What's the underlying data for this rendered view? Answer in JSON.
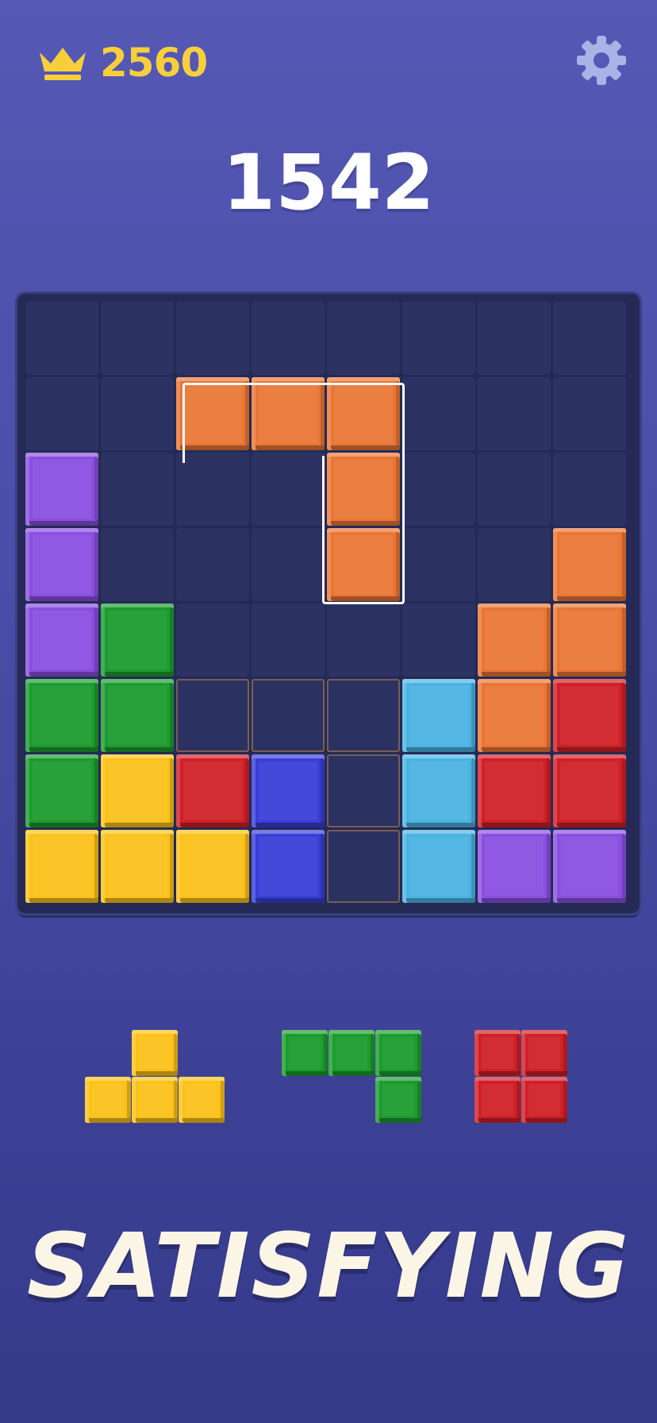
{
  "header": {
    "best_score": "2560",
    "current_score": "1542"
  },
  "colors": {
    "orange": "#ea7636",
    "purple": "#8a4fe0",
    "green": "#1c9c2e",
    "yellow": "#fbc21a",
    "red": "#d02027",
    "blue": "#3a3ed8",
    "cyan": "#4bb3e3",
    "empty": "#2c3363"
  },
  "board": {
    "rows": [
      [
        "empty",
        "empty",
        "empty",
        "empty",
        "empty",
        "empty",
        "empty",
        "empty"
      ],
      [
        "empty",
        "empty",
        "orange",
        "orange",
        "orange",
        "empty",
        "empty",
        "empty"
      ],
      [
        "purple",
        "empty",
        "empty",
        "empty",
        "orange",
        "empty",
        "empty",
        "empty"
      ],
      [
        "purple",
        "empty",
        "empty",
        "empty",
        "orange",
        "empty",
        "empty",
        "orange"
      ],
      [
        "purple",
        "green",
        "empty",
        "empty",
        "empty",
        "empty",
        "orange",
        "orange"
      ],
      [
        "green",
        "green",
        "ghost",
        "ghost",
        "ghost",
        "cyan",
        "orange",
        "red"
      ],
      [
        "green",
        "yellow",
        "red",
        "blue",
        "ghost",
        "cyan",
        "red",
        "red"
      ],
      [
        "yellow",
        "yellow",
        "yellow",
        "blue",
        "ghost",
        "cyan",
        "purple",
        "purple"
      ]
    ]
  },
  "tray": [
    {
      "name": "yellow-t-piece",
      "color": "yellow",
      "shape": [
        [
          0,
          1,
          0
        ],
        [
          1,
          1,
          1
        ]
      ]
    },
    {
      "name": "green-j-piece",
      "color": "green",
      "shape": [
        [
          1,
          1,
          1
        ],
        [
          0,
          0,
          1
        ]
      ]
    },
    {
      "name": "red-square-piece",
      "color": "red",
      "shape": [
        [
          1,
          1
        ],
        [
          1,
          1
        ]
      ]
    }
  ],
  "tagline": "SATISFYING",
  "icons": {
    "best": "crown-icon",
    "settings": "gear-icon"
  }
}
